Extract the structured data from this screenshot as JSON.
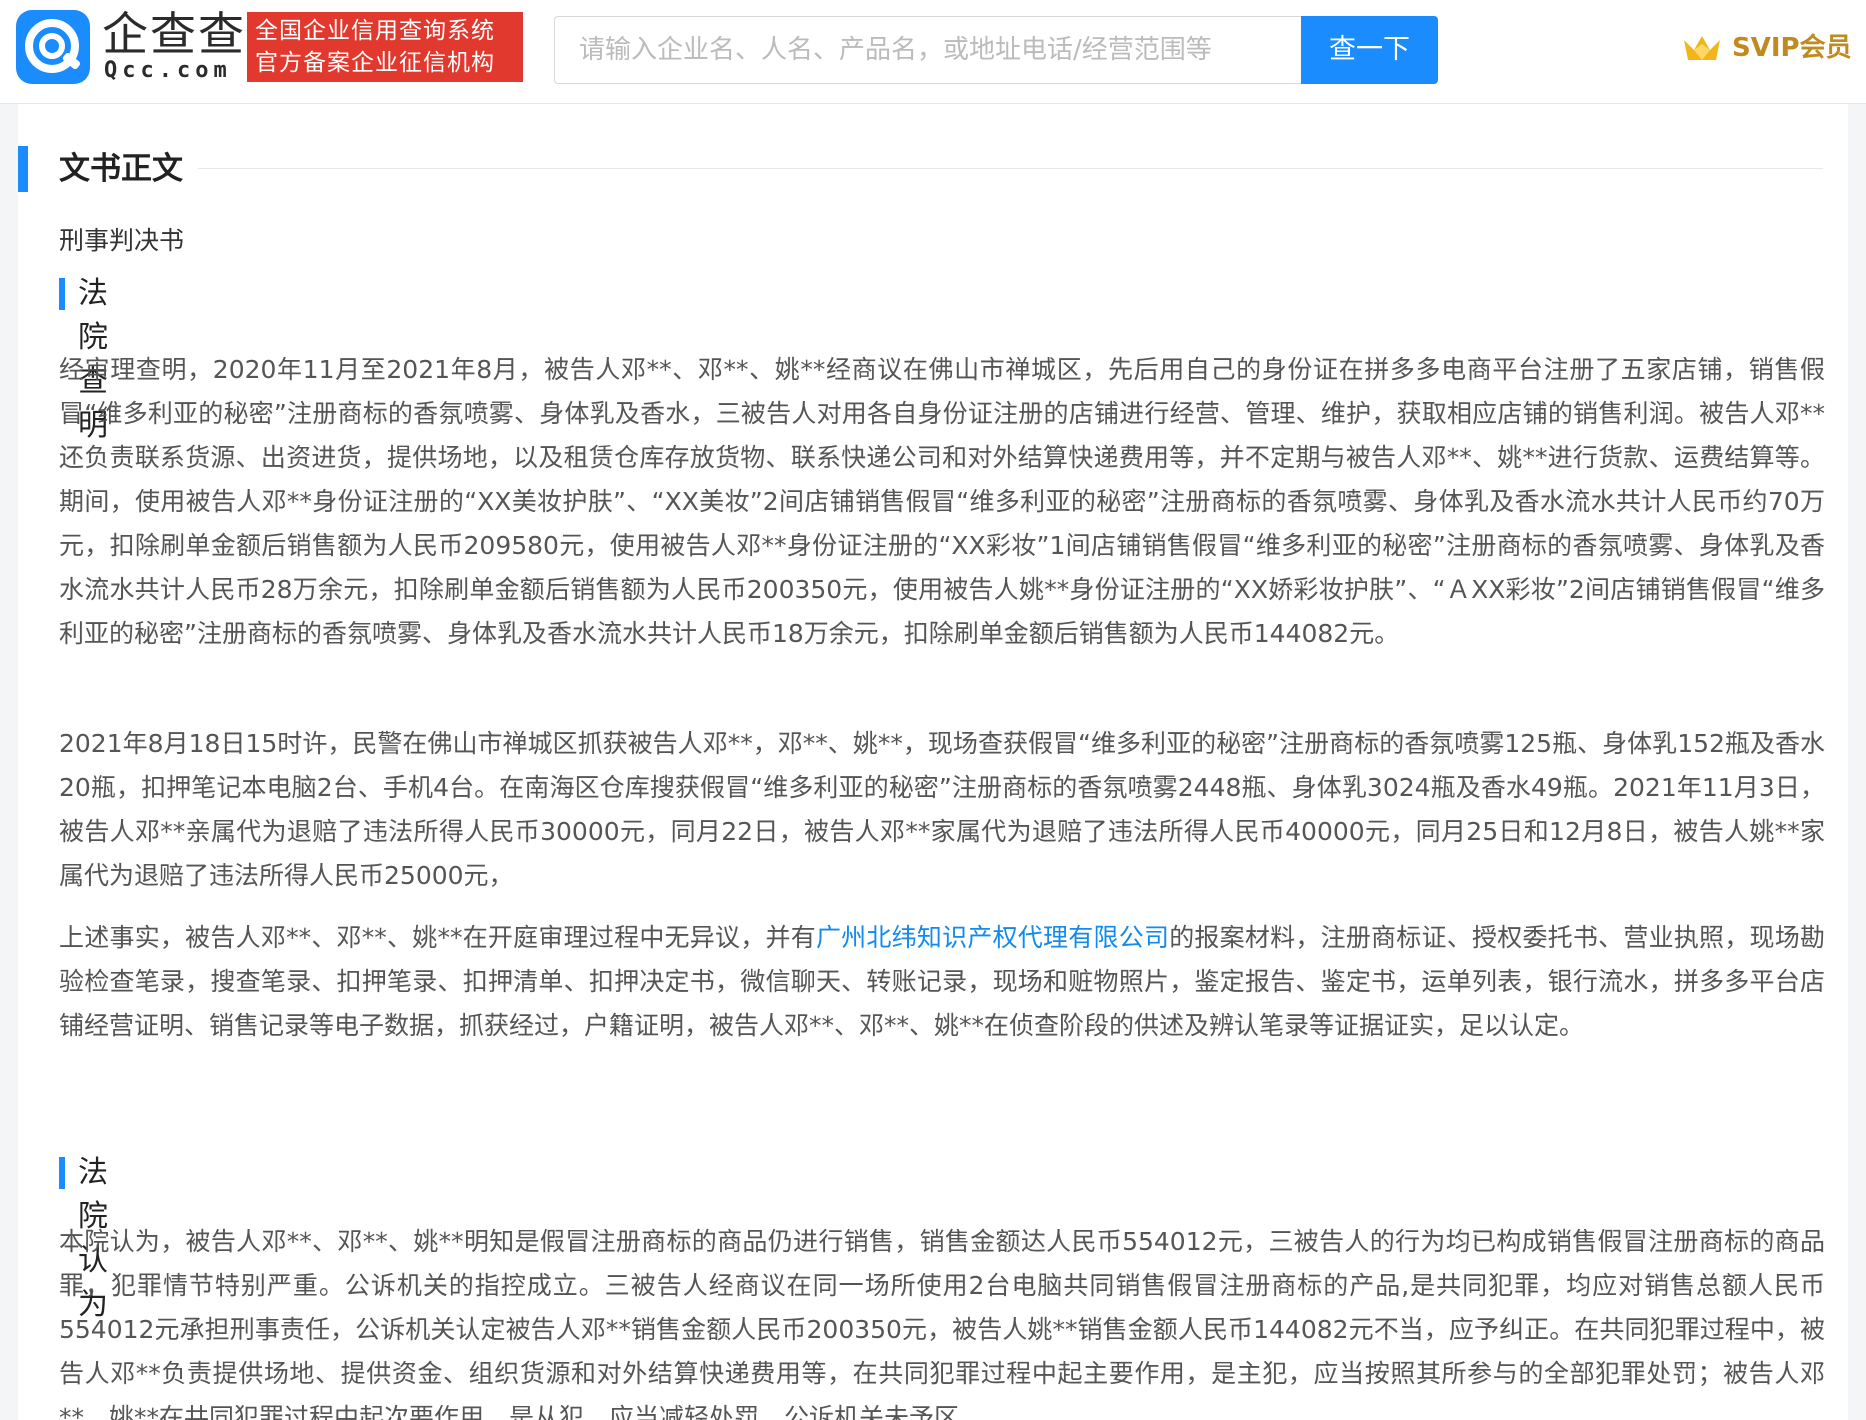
{
  "header": {
    "logo_name": "企查查",
    "logo_domain": "Qcc.com",
    "slogan_line1": "全国企业信用查询系统",
    "slogan_line2": "官方备案企业征信机构",
    "search_placeholder": "请输入企业名、人名、产品名，或地址电话/经营范围等",
    "search_button": "查一下",
    "svip_label": "SVIP会员"
  },
  "document": {
    "section_title": "文书正文",
    "doc_type": "刑事判决书",
    "facts_title": "法院查明",
    "facts_p1": "经审理查明，2020年11月至2021年8月，被告人邓**、邓**、姚**经商议在佛山市禅城区，先后用自己的身份证在拼多多电商平台注册了五家店铺，销售假冒“维多利亚的秘密”注册商标的香氛喷雾、身体乳及香水，三被告人对用各自身份证注册的店铺进行经营、管理、维护，获取相应店铺的销售利润。被告人邓**还负责联系货源、出资进货，提供场地，以及租赁仓库存放货物、联系快递公司和对外结算快递费用等，并不定期与被告人邓**、姚**进行货款、运费结算等。期间，使用被告人邓**身份证注册的“XX美妆护肤”、“XX美妆”2间店铺销售假冒“维多利亚的秘密”注册商标的香氛喷雾、身体乳及香水流水共计人民币约70万元，扣除刷单金额后销售额为人民币209580元，使用被告人邓**身份证注册的“XX彩妆”1间店铺销售假冒“维多利亚的秘密”注册商标的香氛喷雾、身体乳及香水流水共计人民币28万余元，扣除刷单金额后销售额为人民币200350元，使用被告人姚**身份证注册的“XX娇彩妆护肤”、“ＡXX彩妆”2间店铺销售假冒“维多利亚的秘密”注册商标的香氛喷雾、身体乳及香水流水共计人民币18万余元，扣除刷单金额后销售额为人民币144082元。",
    "facts_p2": "2021年8月18日15时许，民警在佛山市禅城区抓获被告人邓**，邓**、姚**，现场查获假冒“维多利亚的秘密”注册商标的香氛喷雾125瓶、身体乳152瓶及香水20瓶，扣押笔记本电脑2台、手机4台。在南海区仓库搜获假冒“维多利亚的秘密”注册商标的香氛喷雾2448瓶、身体乳3024瓶及香水49瓶。2021年11月3日，被告人邓**亲属代为退赔了违法所得人民币30000元，同月22日，被告人邓**家属代为退赔了违法所得人民币40000元，同月25日和12月8日，被告人姚**家属代为退赔了违法所得人民币25000元，",
    "facts_p3_before": "上述事实，被告人邓**、邓**、姚**在开庭审理过程中无异议，并有",
    "facts_p3_link": "广州北纬知识产权代理有限公司",
    "facts_p3_after": "的报案材料，注册商标证、授权委托书、营业执照，现场勘验检查笔录，搜查笔录、扣押笔录、扣押清单、扣押决定书，微信聊天、转账记录，现场和赃物照片，鉴定报告、鉴定书，运单列表，银行流水，拼多多平台店铺经营证明、销售记录等电子数据，抓获经过，户籍证明，被告人邓**、邓**、姚**在侦查阶段的供述及辨认笔录等证据证实，足以认定。",
    "opinion_title": "法院认为",
    "opinion_p1": "本院认为，被告人邓**、邓**、姚**明知是假冒注册商标的商品仍进行销售，销售金额达人民币554012元，三被告人的行为均已构成销售假冒注册商标的商品罪，犯罪情节特别严重。公诉机关的指控成立。三被告人经商议在同一场所使用2台电脑共同销售假冒注册商标的产品,是共同犯罪，均应对销售总额人民币554012元承担刑事责任，公诉机关认定被告人邓**销售金额人民币200350元，被告人姚**销售金额人民币144082元不当，应予纠正。在共同犯罪过程中，被告人邓**负责提供场地、提供资金、组织货源和对外结算快递费用等，在共同犯罪过程中起主要作用，是主犯，应当按照其所参与的全部犯罪处罚；被告人邓**、姚**在共同犯罪过程中起次要作用，是从犯，应当减轻处罚。公诉机关未予区"
  }
}
